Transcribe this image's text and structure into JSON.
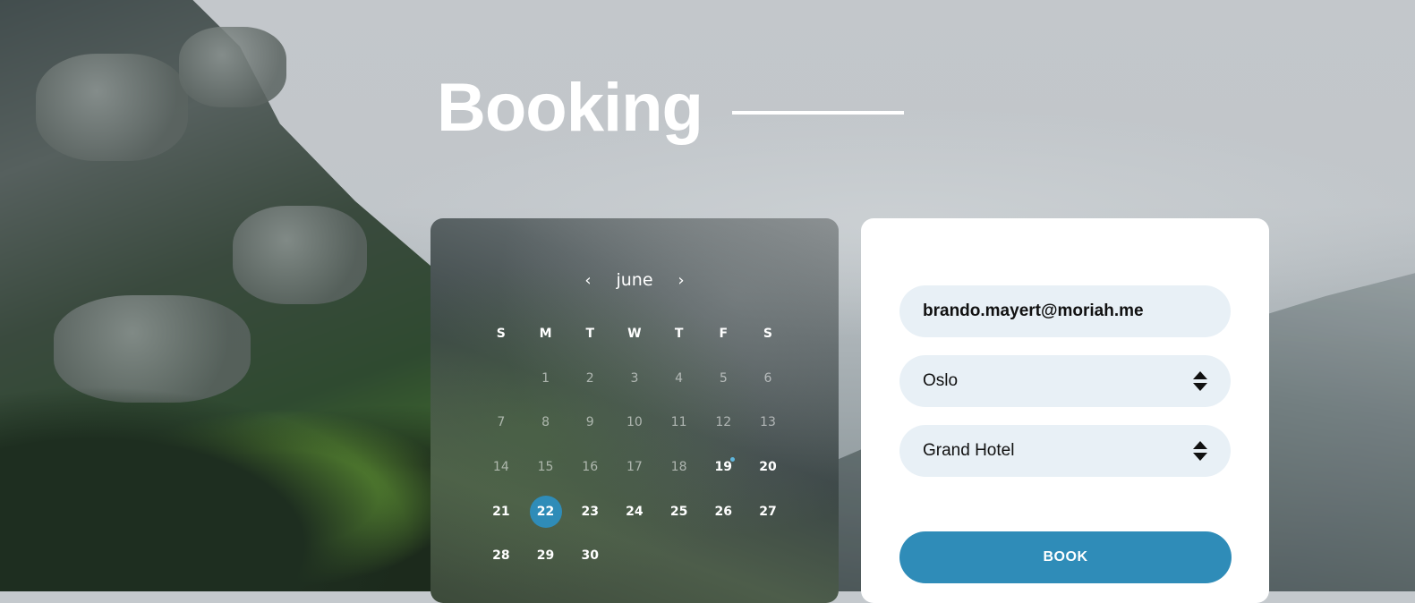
{
  "page": {
    "title": "Booking"
  },
  "calendar": {
    "month": "june",
    "prev_label": "‹",
    "next_label": "›",
    "weekdays": [
      "S",
      "M",
      "T",
      "W",
      "T",
      "F",
      "S"
    ],
    "leading_blanks": 1,
    "days": [
      "1",
      "2",
      "3",
      "4",
      "5",
      "6",
      "7",
      "8",
      "9",
      "10",
      "11",
      "12",
      "13",
      "14",
      "15",
      "16",
      "17",
      "18",
      "19",
      "20",
      "21",
      "22",
      "23",
      "24",
      "25",
      "26",
      "27",
      "28",
      "29",
      "30"
    ],
    "past_days": [
      "1",
      "2",
      "3",
      "4",
      "5",
      "6",
      "7",
      "8",
      "9",
      "10",
      "11",
      "12",
      "13",
      "14",
      "15",
      "16",
      "17",
      "18"
    ],
    "selected_day": "22",
    "marked_day": "19",
    "accent_color": "#2f8cb8"
  },
  "form": {
    "email_value": "brando.mayert@moriah.me",
    "city_value": "Oslo",
    "hotel_value": "Grand Hotel",
    "book_label": "BOOK",
    "button_color": "#2f8cb8",
    "field_background": "#e8f0f6"
  }
}
